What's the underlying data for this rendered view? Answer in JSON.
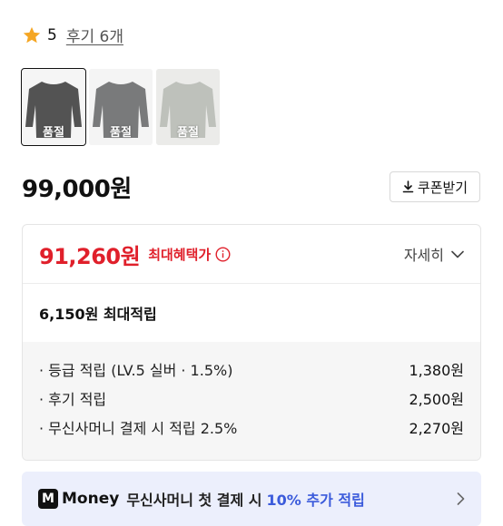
{
  "rating": {
    "score": "5",
    "review_link": "후기 6개",
    "icon": "star-icon",
    "star_color": "#f5a623"
  },
  "thumbnails": [
    {
      "badge": "품절",
      "color": "#1a1a1a",
      "selected": true
    },
    {
      "badge": "품절",
      "color": "#4d4e4f",
      "selected": false
    },
    {
      "badge": "품절",
      "color": "#a9aca4",
      "selected": false
    }
  ],
  "price": "99,000원",
  "coupon_button": {
    "label": "쿠폰받기",
    "icon": "download-icon"
  },
  "benefit": {
    "max_price": "91,260원",
    "max_label": "최대혜택가",
    "detail_label": "자세히",
    "point_summary": "6,150원 최대적립",
    "rows": [
      {
        "label": "· 등급 적립 (LV.5 실버 · 1.5%)",
        "value": "1,380원"
      },
      {
        "label": "· 후기 적립",
        "value": "2,500원"
      },
      {
        "label": "· 무신사머니 결제 시 적립 2.5%",
        "value": "2,270원"
      }
    ],
    "accent_color": "#e0202b"
  },
  "money_banner": {
    "logo_text": "Money",
    "text": "무신사머니 첫 결제 시",
    "highlight": "10% 추가 적립",
    "highlight_color": "#3b5bdb"
  }
}
